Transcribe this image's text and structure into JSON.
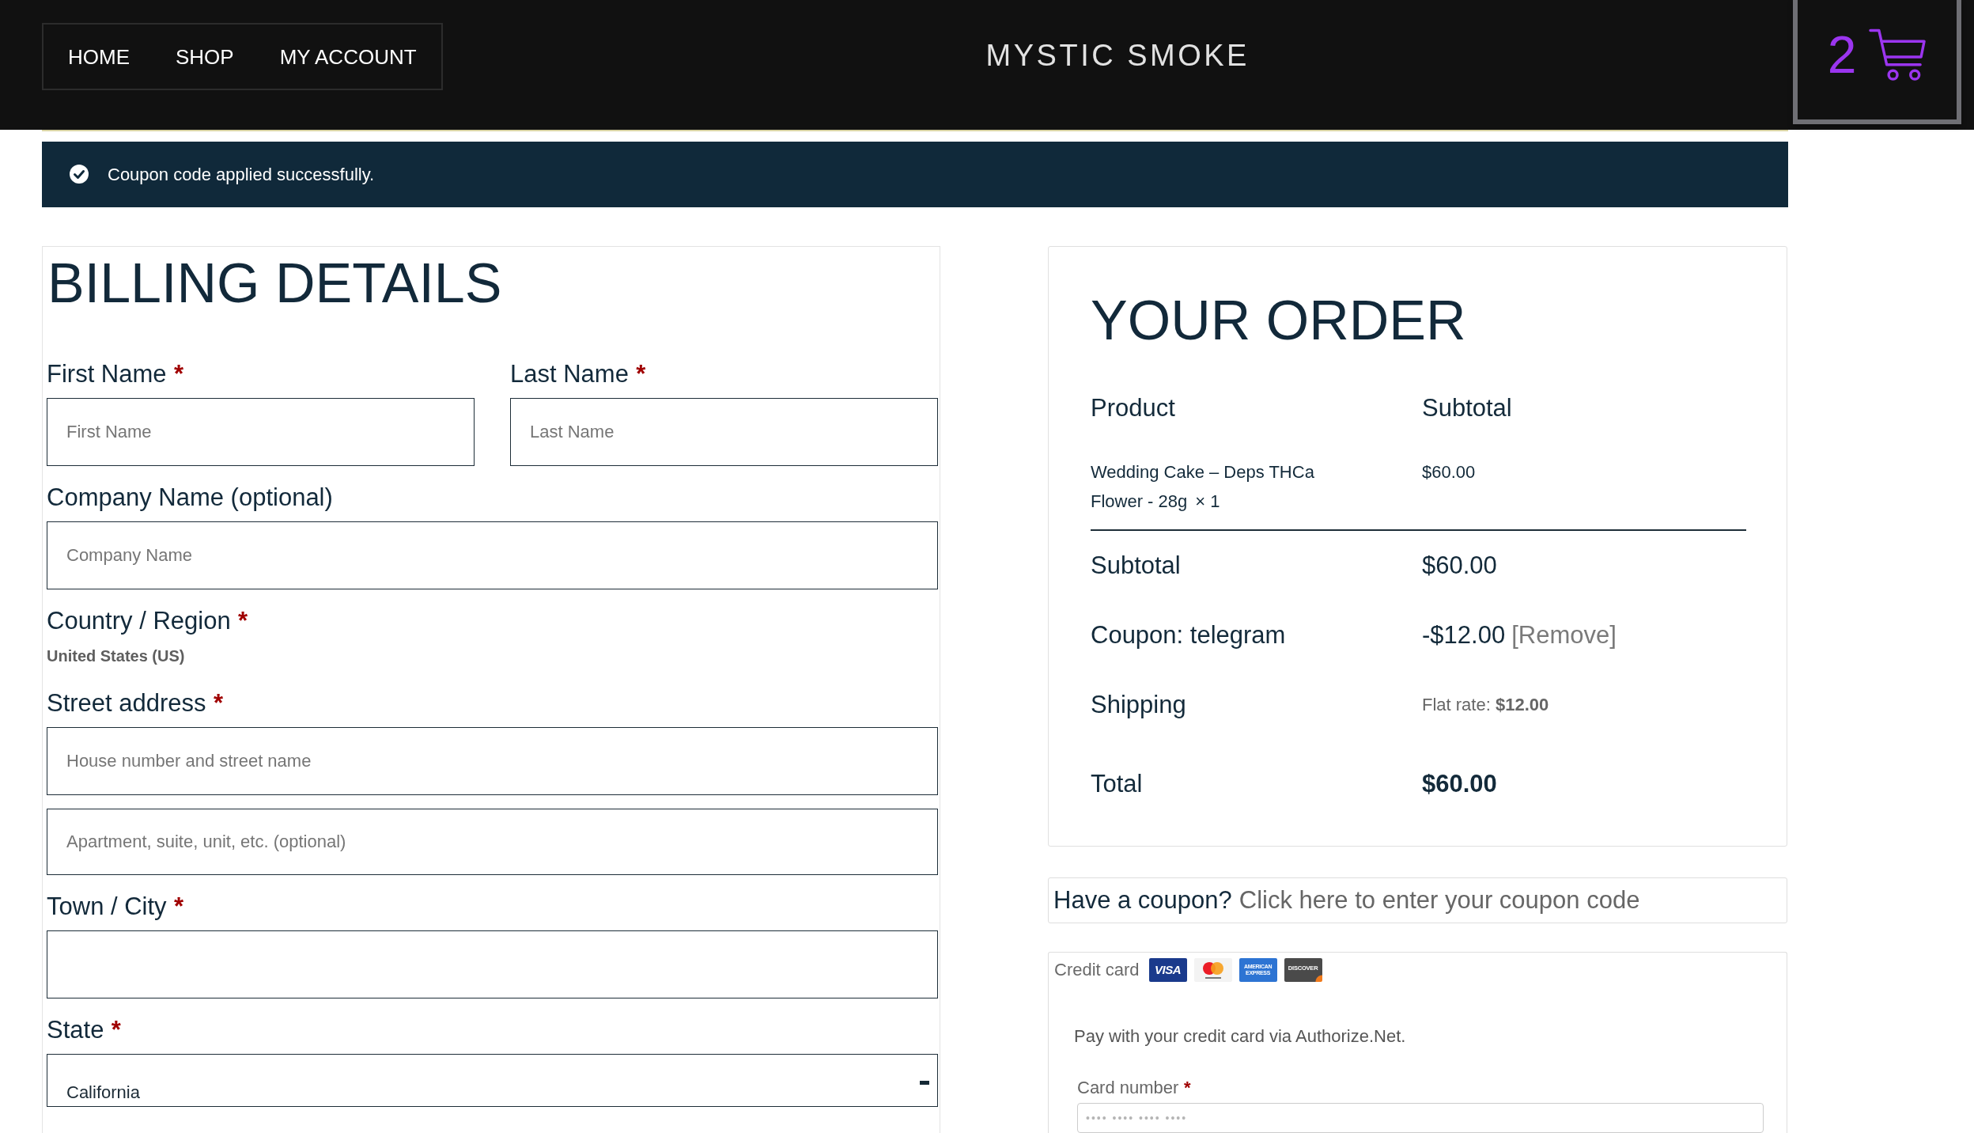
{
  "header": {
    "nav": [
      {
        "label": "HOME"
      },
      {
        "label": "SHOP"
      },
      {
        "label": "MY ACCOUNT"
      }
    ],
    "site_title": "MYSTIC SMOKE",
    "cart": {
      "count": "2"
    }
  },
  "notice": {
    "kind": "success",
    "text": "Coupon code applied successfully."
  },
  "billing": {
    "title": "BILLING DETAILS",
    "rows": [
      {
        "fields": [
          {
            "kind": "text",
            "label": "First Name",
            "required_mark": "*",
            "placeholder": "First Name"
          },
          {
            "kind": "text",
            "label": "Last Name",
            "required_mark": "*",
            "placeholder": "Last Name"
          }
        ]
      },
      {
        "fields": [
          {
            "kind": "text",
            "label": "Company Name (optional)",
            "placeholder": "Company Name"
          }
        ]
      },
      {
        "fields": [
          {
            "kind": "static",
            "label": "Country / Region",
            "required_mark": "*",
            "value": "United States (US)"
          }
        ]
      },
      {
        "fields": [
          {
            "kind": "text",
            "label": "Street address",
            "required_mark": "*",
            "placeholder": "House number and street name"
          }
        ]
      },
      {
        "fields": [
          {
            "kind": "text",
            "placeholder": "Apartment, suite, unit, etc. (optional)"
          }
        ]
      },
      {
        "fields": [
          {
            "kind": "text",
            "label": "Town / City",
            "required_mark": "*"
          }
        ]
      },
      {
        "fields": [
          {
            "kind": "select",
            "label": "State",
            "required_mark": "*",
            "value": "California"
          }
        ]
      }
    ]
  },
  "order": {
    "title": "YOUR ORDER",
    "columns": [
      "Product",
      "Subtotal"
    ],
    "items": [
      {
        "name": "Wedding Cake – Deps THCa Flower - 28g",
        "quantity": "× 1",
        "subtotal": "$60.00"
      }
    ],
    "totals": [
      {
        "kind": "subtotal",
        "label": "Subtotal",
        "value": "$60.00"
      },
      {
        "kind": "coupon",
        "label": "Coupon: telegram",
        "value": "-$12.00",
        "link": "[Remove]"
      },
      {
        "kind": "shipping",
        "label": "Shipping",
        "value": "Flat rate: **$12.00**"
      },
      {
        "kind": "total",
        "label": "Total",
        "value": "$60.00"
      }
    ]
  },
  "coupon_prompt": {
    "text": "Have a coupon?",
    "link": "Click here to enter your coupon code"
  },
  "payment": {
    "method": "Credit card",
    "card_logos": [
      {
        "kind": "visa",
        "label": "VISA"
      },
      {
        "kind": "mastercard"
      },
      {
        "kind": "amex",
        "label": "AMERICAN EXPRESS"
      },
      {
        "kind": "discover",
        "label": "DISCOVER"
      }
    ],
    "description": "Pay with your credit card via Authorize.Net.",
    "fields": [
      {
        "label": "Card number",
        "required_mark": "*",
        "placeholder": "•••• •••• •••• ••••"
      }
    ]
  }
}
